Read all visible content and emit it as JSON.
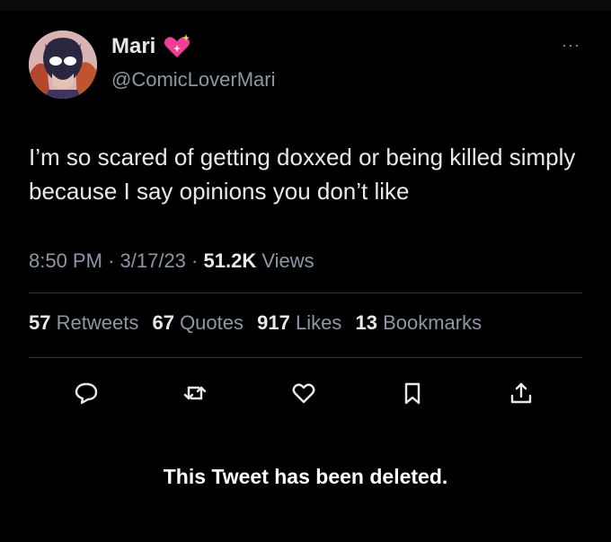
{
  "tweet": {
    "author_name": "Mari",
    "handle": "@ComicLoverMari",
    "text": "I’m so scared of getting doxxed or being killed simply because I say opinions you don’t like",
    "time": "8:50 PM",
    "date": "3/17/23",
    "views_count": "51.2K",
    "views_label": "Views",
    "more_label": "···"
  },
  "stats": [
    {
      "count": "57",
      "label": "Retweets"
    },
    {
      "count": "67",
      "label": "Quotes"
    },
    {
      "count": "917",
      "label": "Likes"
    },
    {
      "count": "13",
      "label": "Bookmarks"
    }
  ],
  "actions": [
    "reply-icon",
    "retweet-icon",
    "like-icon",
    "bookmark-icon",
    "share-icon"
  ],
  "notice": "This Tweet has been deleted.",
  "colors": {
    "background": "#000000",
    "primary_text": "#e7e9ea",
    "secondary_text": "#8b98a5",
    "divider": "#2f3336",
    "heart": "#f23d9a"
  }
}
